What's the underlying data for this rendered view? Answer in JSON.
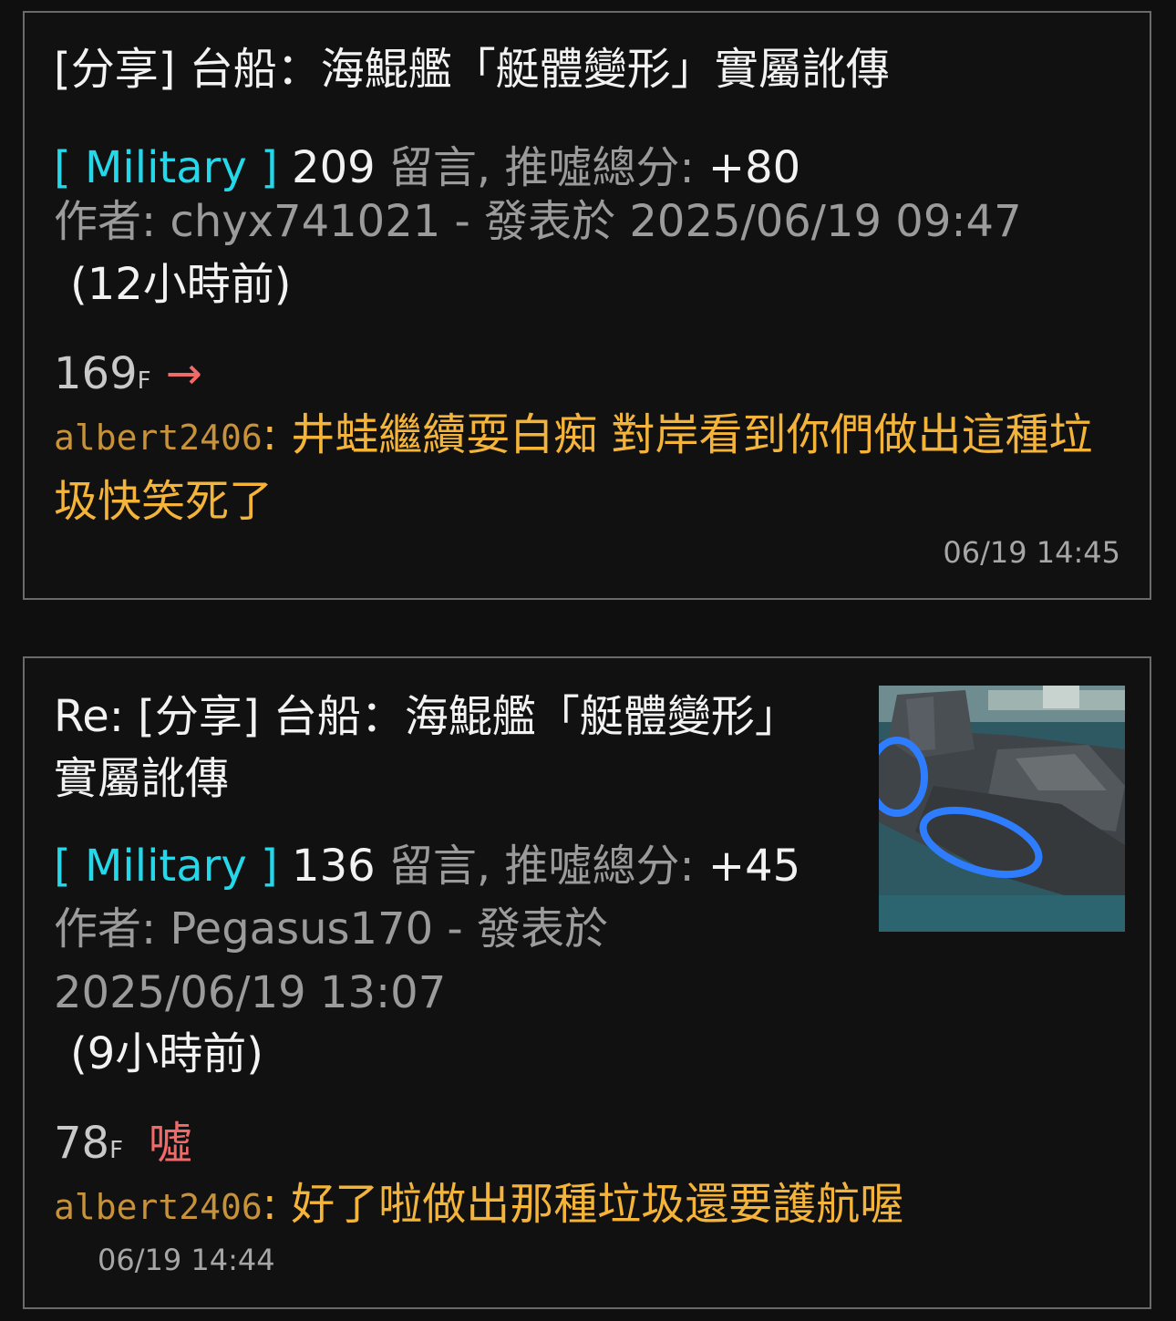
{
  "posts": [
    {
      "title": "[分享] 台船：海鯤艦「艇體變形」實屬訛傳",
      "board": "[ Military ]",
      "comment_count": "209",
      "count_label": "留言, 推噓總分: ",
      "score": "+80",
      "author_line": "作者: chyx741021 - 發表於 2025/06/19 09:47",
      "age": "(12小時前)",
      "floor_number": "169",
      "floor_suffix": "F",
      "tag": "→",
      "comment_user": "albert2406",
      "comment_text": ": 井蛙繼續耍白痴 對岸看到你們做出這種垃圾快笑死了",
      "comment_time": "06/19 14:45"
    },
    {
      "title": "Re: [分享] 台船：海鯤艦「艇體變形」實屬訛傳",
      "board": "[ Military ]",
      "comment_count": "136",
      "count_label": "留言, 推噓總分: ",
      "score": "+45",
      "author_line": "作者: Pegasus170 - 發表於 2025/06/19 13:07",
      "age": "(9小時前)",
      "floor_number": "78",
      "floor_suffix": "F",
      "tag": "噓",
      "comment_user": "albert2406",
      "comment_text": ": 好了啦做出那種垃圾還要護航喔",
      "comment_time": "06/19 14:44",
      "thumbnail": "submarine-photo"
    }
  ],
  "colors": {
    "background": "#0f0f10",
    "border": "#6a6a6a",
    "board": "#24d8ea",
    "comment": "#f4b43a",
    "tag": "#f06a6a",
    "muted": "#9b9b9b"
  }
}
